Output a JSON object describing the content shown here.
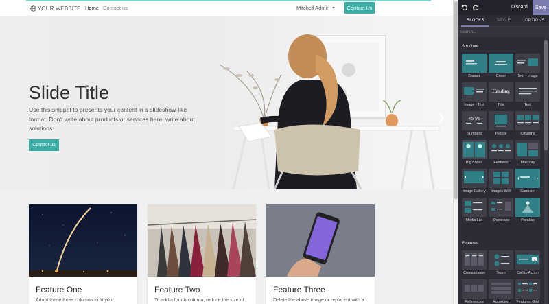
{
  "website": {
    "logo_text": "YOUR WEBSITE",
    "nav": {
      "home": "Home",
      "contact": "Contact us",
      "user": "Mitchell Admin",
      "contact_button": "Contact Us"
    },
    "hero": {
      "title": "Slide Title",
      "text": "Use this snippet to presents your content in a slideshow-like format. Don't write about products or services here, write about solutions.",
      "button": "Contact us"
    },
    "features": [
      {
        "title": "Feature One",
        "text": "Adapt these three columns to fit your"
      },
      {
        "title": "Feature Two",
        "text": "To add a fourth column, reduce the size of"
      },
      {
        "title": "Feature Three",
        "text": "Delete the above image or replace it with a"
      }
    ]
  },
  "editor": {
    "discard": "Discard",
    "save": "Save",
    "tabs": {
      "blocks": "BLOCKS",
      "style": "STYLE",
      "options": "OPTIONS"
    },
    "search_placeholder": "Search...",
    "structure_label": "Structure",
    "structure_blocks": [
      {
        "label": "Banner",
        "icon": "banner-icon"
      },
      {
        "label": "Cover",
        "icon": "cover-icon"
      },
      {
        "label": "Text - Image",
        "icon": "text-image-icon"
      },
      {
        "label": "Image - Text",
        "icon": "image-text-icon"
      },
      {
        "label": "Title",
        "icon": "title-icon",
        "thumb_text": "Heading"
      },
      {
        "label": "Text",
        "icon": "text-icon"
      },
      {
        "label": "Numbers",
        "icon": "numbers-icon",
        "thumb_text": "45 91"
      },
      {
        "label": "Picture",
        "icon": "picture-icon"
      },
      {
        "label": "Columns",
        "icon": "columns-icon"
      },
      {
        "label": "Big Boxes",
        "icon": "big-boxes-icon"
      },
      {
        "label": "Features",
        "icon": "features-icon"
      },
      {
        "label": "Masonry",
        "icon": "masonry-icon"
      },
      {
        "label": "Image Gallery",
        "icon": "image-gallery-icon"
      },
      {
        "label": "Images Wall",
        "icon": "images-wall-icon"
      },
      {
        "label": "Carousel",
        "icon": "carousel-icon"
      },
      {
        "label": "Media List",
        "icon": "media-list-icon"
      },
      {
        "label": "Showcase",
        "icon": "showcase-icon"
      },
      {
        "label": "Parallax",
        "icon": "parallax-icon"
      }
    ],
    "features_label": "Features",
    "feature_blocks": [
      {
        "label": "Comparisons",
        "icon": "comparisons-icon"
      },
      {
        "label": "Team",
        "icon": "team-icon"
      },
      {
        "label": "Call to Action",
        "icon": "call-to-action-icon"
      },
      {
        "label": "References",
        "icon": "references-icon"
      },
      {
        "label": "Accordion",
        "icon": "accordion-icon"
      },
      {
        "label": "Features Grid",
        "icon": "features-grid-icon"
      }
    ]
  },
  "colors": {
    "accent": "#3aada5",
    "panel_bg": "#2c2c36",
    "save": "#7c7bad",
    "thumb_teal": "#2f7f86"
  }
}
